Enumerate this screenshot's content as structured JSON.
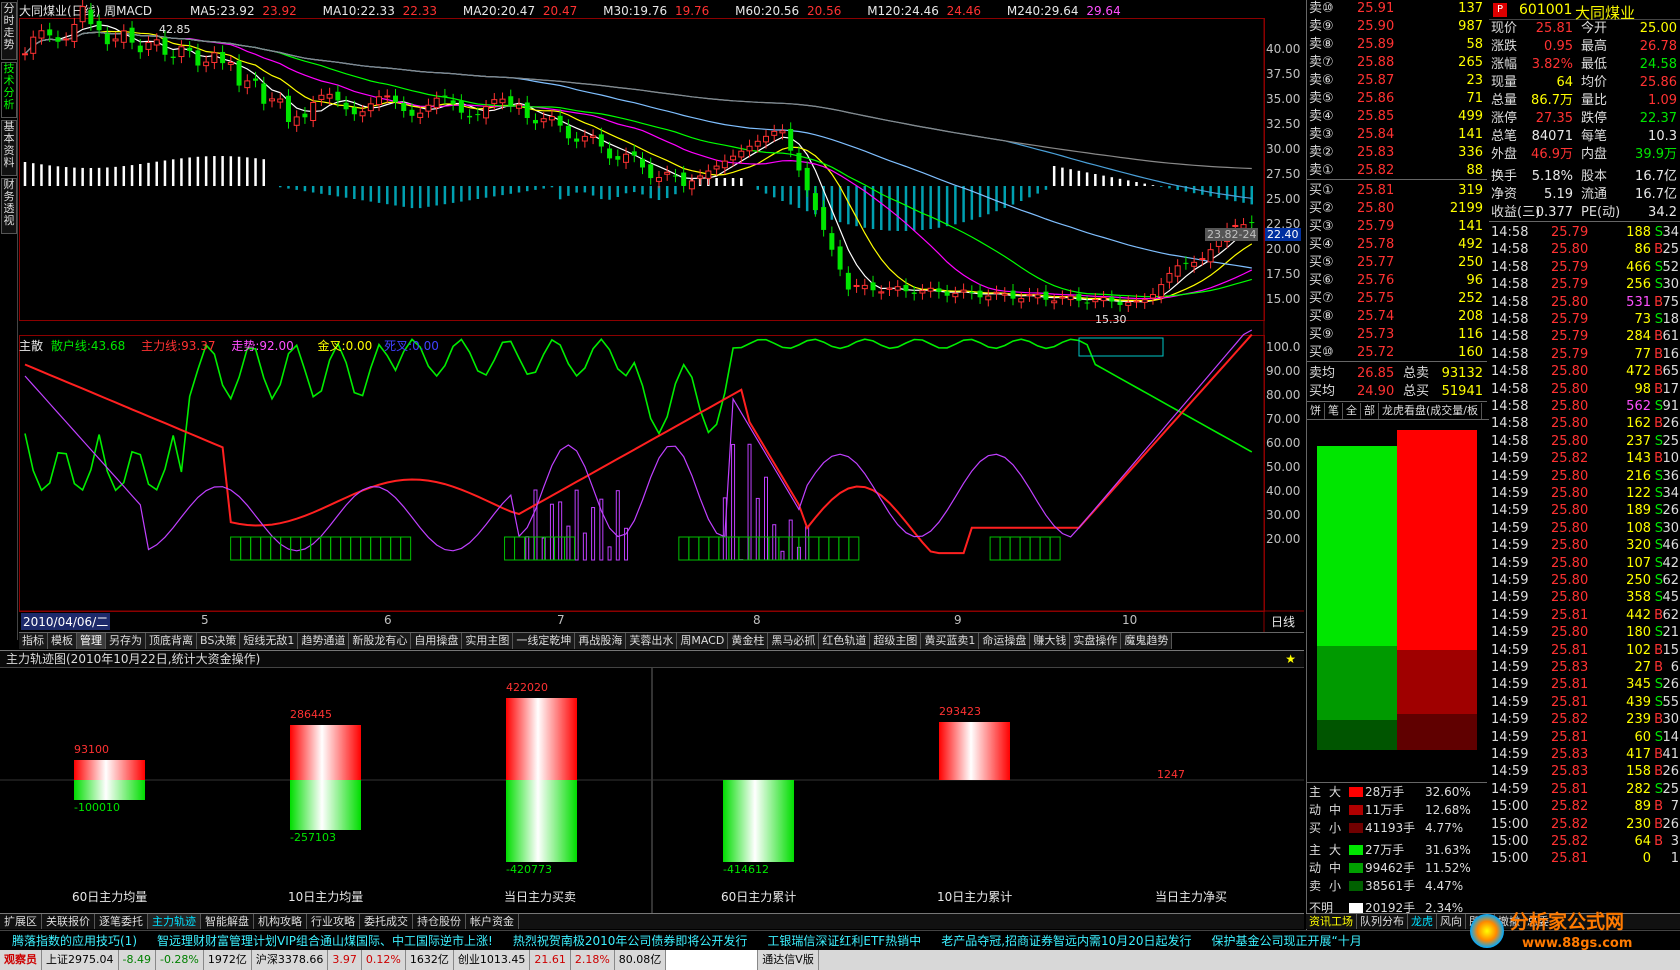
{
  "vtabs": [
    "分时走势",
    "技术分析",
    "基本资料",
    "财务透视"
  ],
  "title": {
    "stock": "大同煤业(日线) 周MACD",
    "ma5": "MA5:23.92",
    "ma5v": "23.92",
    "ma10": "MA10:22.33",
    "ma10v": "22.33",
    "ma20": "MA20:20.47",
    "ma20v": "20.47",
    "m30": "M30:19.76",
    "m30v": "19.76",
    "m60": "M60:20.56",
    "m60v": "20.56",
    "m120": "M120:24.46",
    "m120v": "24.46",
    "m240": "M240:29.64",
    "m240v": "29.64"
  },
  "price_axis": [
    "40.00",
    "37.50",
    "35.00",
    "32.50",
    "30.00",
    "27.50",
    "25.00",
    "22.50",
    "20.00",
    "17.50",
    "15.00"
  ],
  "price_marks": {
    "high": "42.85",
    "low": "15.30",
    "cur_box": "23.82-24",
    "cur_tag": "22.40"
  },
  "ind_title": {
    "name": "主散",
    "a": "散户线:43.68",
    "b": "主力线:93.37",
    "c": "走势:92.00",
    "d": "金叉:0.00",
    "e": "死叉:0.00"
  },
  "ind_axis": [
    "100.0",
    "90.00",
    "80.00",
    "70.00",
    "60.00",
    "50.00",
    "40.00",
    "30.00",
    "20.00"
  ],
  "date_axis": {
    "start": "2010/04/06/二",
    "m5": "5",
    "m6": "6",
    "m7": "7",
    "m8": "8",
    "m9": "9",
    "m10": "10",
    "period": "日线"
  },
  "ind_tabs": [
    "指标",
    "模板",
    "管理",
    "另存为",
    "顶底背离",
    "BS决策",
    "短线无敌1",
    "趋势通道",
    "新股龙有心",
    "自用操盘",
    "实用主图",
    "一线定乾坤",
    "再战股海",
    "芙蓉出水",
    "周MACD",
    "黄金柱",
    "黑马必抓",
    "红色轨道",
    "超级主图",
    "黄买蓝卖1",
    "命运操盘",
    "赚大钱",
    "实盘操作",
    "魔鬼趋势"
  ],
  "panel_title": "主力轨迹图(2010年10月22日,统计大资金操作)",
  "flow": {
    "b1_up": "93100",
    "b1_dn": "-100010",
    "b1_label": "60日主力均量",
    "b2_up": "286445",
    "b2_dn": "-257103",
    "b2_label": "10日主力均量",
    "b3_up": "422020",
    "b3_dn": "-420773",
    "b3_label": "当日主力买卖",
    "b4_dn": "-414612",
    "b4_label": "60日主力累计",
    "b5_up": "293423",
    "b5_label": "10日主力累计",
    "b6_up": "1247",
    "b6_label": "当日主力净买"
  },
  "bottom_tabs": [
    "扩展区",
    "关联报价",
    "逐笔委托",
    "主力轨迹",
    "智能解盘",
    "机构攻略",
    "行业攻略",
    "委托成交",
    "持仓股份",
    "帐户资金"
  ],
  "ticker": [
    "腾落指数的应用技巧(1)",
    "智远理财财富管理计划VIP组合通山煤国际、中工国际逆市上涨!",
    "热烈祝贺南极2010年公司债券即将公开发行",
    "工银瑞信深证红利ETF热销中",
    "老产品夺冠,招商证券智远内需10月20日起发行",
    "保护基金公司现正开展“十月"
  ],
  "status": {
    "a": "观察员",
    "b": "上证2975.04",
    "c": "-8.49",
    "d": "-0.28%",
    "e": "1972亿",
    "f": "沪深3378.66",
    "g": "3.97",
    "h": "0.12%",
    "i": "1632亿",
    "j": "创业1013.45",
    "k": "21.61",
    "l": "2.18%",
    "m": "80.08亿",
    "n": "通达信V版"
  },
  "right_tabs": {
    "info": "资讯工场",
    "queue": "队列分布",
    "dragon": "龙虎",
    "fx": "风向",
    "jjs": "即搬",
    "zc": "撤撤",
    "total": "总委"
  },
  "quote_header": {
    "code": "601001",
    "name": "大同煤业"
  },
  "sell": [
    {
      "l": "卖⑩",
      "p": "25.91",
      "v": "137"
    },
    {
      "l": "卖⑨",
      "p": "25.90",
      "v": "987"
    },
    {
      "l": "卖⑧",
      "p": "25.89",
      "v": "58"
    },
    {
      "l": "卖⑦",
      "p": "25.88",
      "v": "265"
    },
    {
      "l": "卖⑥",
      "p": "25.87",
      "v": "23"
    },
    {
      "l": "卖⑤",
      "p": "25.86",
      "v": "71"
    },
    {
      "l": "卖④",
      "p": "25.85",
      "v": "499"
    },
    {
      "l": "卖③",
      "p": "25.84",
      "v": "141"
    },
    {
      "l": "卖②",
      "p": "25.83",
      "v": "336"
    },
    {
      "l": "卖①",
      "p": "25.82",
      "v": "88"
    }
  ],
  "buy": [
    {
      "l": "买①",
      "p": "25.81",
      "v": "319"
    },
    {
      "l": "买②",
      "p": "25.80",
      "v": "2199"
    },
    {
      "l": "买③",
      "p": "25.79",
      "v": "141"
    },
    {
      "l": "买④",
      "p": "25.78",
      "v": "492"
    },
    {
      "l": "买⑤",
      "p": "25.77",
      "v": "250"
    },
    {
      "l": "买⑥",
      "p": "25.76",
      "v": "96"
    },
    {
      "l": "买⑦",
      "p": "25.75",
      "v": "252"
    },
    {
      "l": "买⑧",
      "p": "25.74",
      "v": "208"
    },
    {
      "l": "买⑨",
      "p": "25.73",
      "v": "116"
    },
    {
      "l": "买⑩",
      "p": "25.72",
      "v": "160"
    }
  ],
  "avg": {
    "l1": "卖均",
    "p1": "26.85",
    "l2": "总卖",
    "v1": "93132",
    "l3": "买均",
    "p2": "24.90",
    "l4": "总买",
    "v2": "51941"
  },
  "ob_tabs": [
    "饼",
    "笔",
    "全",
    "部",
    "龙虎看盘(成交量/板"
  ],
  "quote": [
    {
      "a": "现价",
      "b": "25.81",
      "c": "今开",
      "d": "25.00",
      "bc": "red",
      "dc": "yel"
    },
    {
      "a": "涨跌",
      "b": "0.95",
      "c": "最高",
      "d": "26.78",
      "bc": "red",
      "dc": "red"
    },
    {
      "a": "涨幅",
      "b": "3.82%",
      "c": "最低",
      "d": "24.58",
      "bc": "red",
      "dc": "grn"
    },
    {
      "a": "现量",
      "b": "64",
      "c": "均价",
      "d": "25.86",
      "bc": "yel",
      "dc": "red"
    },
    {
      "a": "总量",
      "b": "86.7万",
      "c": "量比",
      "d": "1.09",
      "bc": "yel",
      "dc": "red"
    },
    {
      "a": "涨停",
      "b": "27.35",
      "c": "跌停",
      "d": "22.37",
      "bc": "red",
      "dc": "grn"
    },
    {
      "a": "总笔",
      "b": "84071",
      "c": "每笔",
      "d": "10.3",
      "bc": "wht",
      "dc": "wht"
    },
    {
      "a": "外盘",
      "b": "46.9万",
      "c": "内盘",
      "d": "39.9万",
      "bc": "red",
      "dc": "grn"
    },
    {
      "a": "换手",
      "b": "5.18%",
      "c": "股本",
      "d": "16.7亿",
      "bc": "wht",
      "dc": "wht"
    },
    {
      "a": "净资",
      "b": "5.19",
      "c": "流通",
      "d": "16.7亿",
      "bc": "wht",
      "dc": "wht"
    },
    {
      "a": "收益(三)",
      "b": "0.377",
      "c": "PE(动)",
      "d": "34.2",
      "bc": "wht",
      "dc": "wht"
    }
  ],
  "ticks": [
    {
      "t": "14:58",
      "p": "25.79",
      "v": "188",
      "s": "S",
      "n": "34"
    },
    {
      "t": "14:58",
      "p": "25.80",
      "v": "86",
      "s": "B",
      "n": "25"
    },
    {
      "t": "14:58",
      "p": "25.79",
      "v": "466",
      "s": "S",
      "n": "52"
    },
    {
      "t": "14:58",
      "p": "25.79",
      "v": "256",
      "s": "S",
      "n": "30"
    },
    {
      "t": "14:58",
      "p": "25.80",
      "v": "531",
      "s": "B",
      "n": "75"
    },
    {
      "t": "14:58",
      "p": "25.79",
      "v": "73",
      "s": "S",
      "n": "18"
    },
    {
      "t": "14:58",
      "p": "25.79",
      "v": "284",
      "s": "B",
      "n": "61"
    },
    {
      "t": "14:58",
      "p": "25.79",
      "v": "77",
      "s": "B",
      "n": "16"
    },
    {
      "t": "14:58",
      "p": "25.80",
      "v": "472",
      "s": "B",
      "n": "65"
    },
    {
      "t": "14:58",
      "p": "25.80",
      "v": "98",
      "s": "B",
      "n": "17"
    },
    {
      "t": "14:58",
      "p": "25.80",
      "v": "562",
      "s": "S",
      "n": "91"
    },
    {
      "t": "14:58",
      "p": "25.80",
      "v": "162",
      "s": "B",
      "n": "26"
    },
    {
      "t": "14:58",
      "p": "25.80",
      "v": "237",
      "s": "S",
      "n": "25"
    },
    {
      "t": "14:59",
      "p": "25.82",
      "v": "143",
      "s": "B",
      "n": "10"
    },
    {
      "t": "14:59",
      "p": "25.80",
      "v": "216",
      "s": "S",
      "n": "36"
    },
    {
      "t": "14:59",
      "p": "25.80",
      "v": "122",
      "s": "S",
      "n": "34"
    },
    {
      "t": "14:59",
      "p": "25.80",
      "v": "189",
      "s": "S",
      "n": "26"
    },
    {
      "t": "14:59",
      "p": "25.80",
      "v": "108",
      "s": "S",
      "n": "30"
    },
    {
      "t": "14:59",
      "p": "25.80",
      "v": "320",
      "s": "S",
      "n": "46"
    },
    {
      "t": "14:59",
      "p": "25.80",
      "v": "107",
      "s": "S",
      "n": "42"
    },
    {
      "t": "14:59",
      "p": "25.80",
      "v": "250",
      "s": "S",
      "n": "62"
    },
    {
      "t": "14:59",
      "p": "25.80",
      "v": "358",
      "s": "S",
      "n": "45"
    },
    {
      "t": "14:59",
      "p": "25.81",
      "v": "442",
      "s": "B",
      "n": "62"
    },
    {
      "t": "14:59",
      "p": "25.80",
      "v": "180",
      "s": "S",
      "n": "21"
    },
    {
      "t": "14:59",
      "p": "25.81",
      "v": "102",
      "s": "B",
      "n": "15"
    },
    {
      "t": "14:59",
      "p": "25.83",
      "v": "27",
      "s": "B",
      "n": "6"
    },
    {
      "t": "14:59",
      "p": "25.81",
      "v": "345",
      "s": "S",
      "n": "26"
    },
    {
      "t": "14:59",
      "p": "25.81",
      "v": "439",
      "s": "S",
      "n": "55"
    },
    {
      "t": "14:59",
      "p": "25.82",
      "v": "239",
      "s": "B",
      "n": "30"
    },
    {
      "t": "14:59",
      "p": "25.81",
      "v": "60",
      "s": "S",
      "n": "14"
    },
    {
      "t": "14:59",
      "p": "25.83",
      "v": "417",
      "s": "B",
      "n": "41"
    },
    {
      "t": "14:59",
      "p": "25.83",
      "v": "158",
      "s": "B",
      "n": "26"
    },
    {
      "t": "14:59",
      "p": "25.81",
      "v": "282",
      "s": "S",
      "n": "25"
    },
    {
      "t": "15:00",
      "p": "25.82",
      "v": "89",
      "s": "B",
      "n": "7"
    },
    {
      "t": "15:00",
      "p": "25.82",
      "v": "230",
      "s": "B",
      "n": "26"
    },
    {
      "t": "15:00",
      "p": "25.82",
      "v": "64",
      "s": "B",
      "n": "3"
    },
    {
      "t": "15:00",
      "p": "25.81",
      "v": "0",
      "s": "",
      "n": "1"
    }
  ],
  "moneyflow": [
    {
      "c1": "主",
      "c2": "大",
      "col": "#ff0000",
      "c3": "28万手",
      "c4": "32.60%"
    },
    {
      "c1": "动",
      "c2": "中",
      "col": "#b00000",
      "c3": "11万手",
      "c4": "12.68%"
    },
    {
      "c1": "买",
      "c2": "小",
      "col": "#700000",
      "c3": "41193手",
      "c4": "4.77%"
    },
    {
      "c1": "主",
      "c2": "大",
      "col": "#00e600",
      "c3": "27万手",
      "c4": "31.63%"
    },
    {
      "c1": "动",
      "c2": "中",
      "col": "#00a000",
      "c3": "99462手",
      "c4": "11.52%"
    },
    {
      "c1": "卖",
      "c2": "小",
      "col": "#006000",
      "c3": "38561手",
      "c4": "4.47%"
    },
    {
      "c1": "不明",
      "c2": "",
      "col": "#ffffff",
      "c3": "20192手",
      "c4": "2.34%"
    }
  ],
  "logo": {
    "a": "分析家公式网",
    "b": "www.88gs.com"
  },
  "colors": {
    "up": "#ff3232",
    "down": "#00e600",
    "vol": "#ffff00",
    "bg": "#000000",
    "grid": "#8b0000"
  }
}
